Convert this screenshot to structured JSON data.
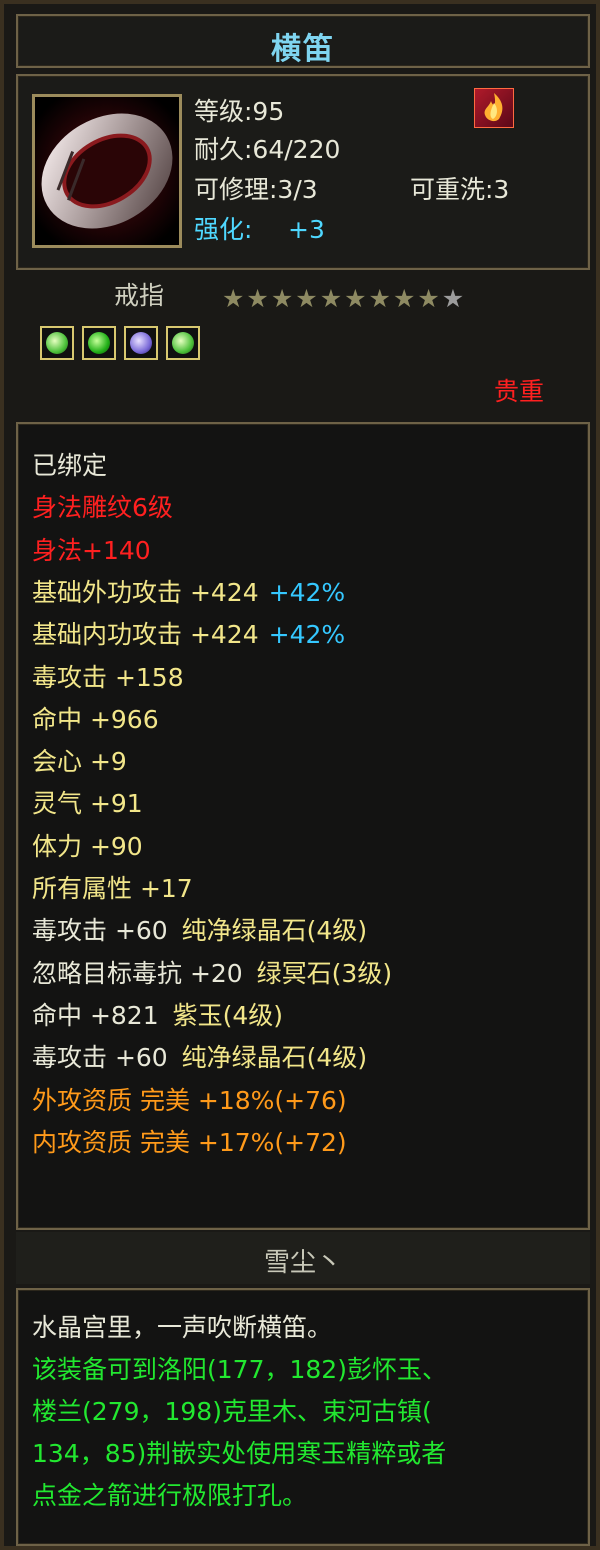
{
  "item": {
    "name": "横笛",
    "level": "等级:95",
    "durability": "耐久:64/220",
    "repairable": "可修理:3/3",
    "rewashable": "可重洗:3",
    "enhance_label": "强化:",
    "enhance_value": "+3",
    "type": "戒指",
    "rarity": "贵重",
    "stars_filled": 9,
    "stars_total": 10,
    "gems": [
      "green-gem-icon",
      "green-leaf-gem-icon",
      "purple-gem-icon",
      "green-gem-icon"
    ]
  },
  "attributes": [
    {
      "text": "已绑定",
      "color": "white"
    },
    {
      "text": "身法雕纹6级",
      "color": "red"
    },
    {
      "text": "身法+140",
      "color": "red"
    },
    {
      "text": "基础外功攻击 +424",
      "extra": "+42%",
      "color": "yellow"
    },
    {
      "text": "基础内功攻击 +424",
      "extra": "+42%",
      "color": "yellow"
    },
    {
      "text": "毒攻击 +158",
      "color": "yellow"
    },
    {
      "text": "命中 +966",
      "color": "yellow"
    },
    {
      "text": "会心 +9",
      "color": "yellow"
    },
    {
      "text": "灵气 +91",
      "color": "yellow"
    },
    {
      "text": "体力 +90",
      "color": "yellow"
    },
    {
      "text": "所有属性 +17",
      "color": "yellow"
    },
    {
      "text": "毒攻击 +60 ",
      "gem": "纯净绿晶石(4级)",
      "color": "white"
    },
    {
      "text": "忽略目标毒抗 +20 ",
      "gem": "绿冥石(3级)",
      "color": "white"
    },
    {
      "text": "命中 +821 ",
      "gem": "紫玉(4级)",
      "color": "white"
    },
    {
      "text": "毒攻击 +60 ",
      "gem": "纯净绿晶石(4级)",
      "color": "white"
    },
    {
      "text": "外攻资质  完美 +18%(+76)",
      "color": "orange"
    },
    {
      "text": "内攻资质  完美 +17%(+72)",
      "color": "orange"
    }
  ],
  "signature": "雪尘丶",
  "description": {
    "flavor": "水晶宫里，一声吹断横笛。",
    "lines": [
      "该装备可到洛阳(177，182)彭怀玉、",
      "楼兰(279，198)克里木、束河古镇(",
      "134，85)荆嵌实处使用寒玉精粹或者",
      "点金之箭进行极限打孔。"
    ]
  },
  "colors": {
    "title": "#7fd5f0",
    "red": "#ff2020",
    "yellow": "#f2e68a",
    "orange": "#ff9a1a",
    "green": "#22e830",
    "cyan": "#4fd8ff"
  }
}
